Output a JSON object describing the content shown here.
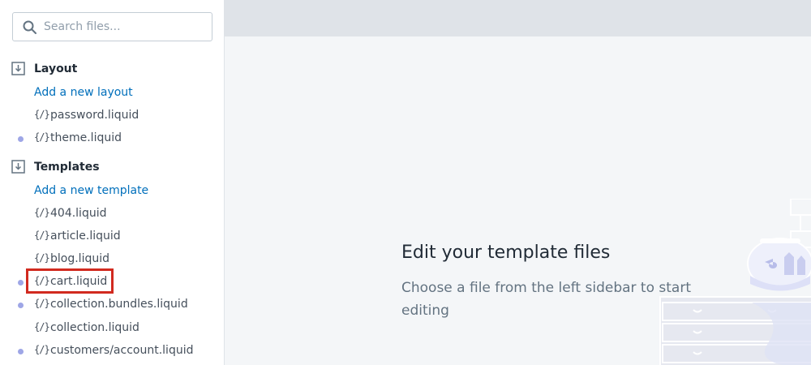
{
  "search": {
    "placeholder": "Search files..."
  },
  "sections": {
    "layout": {
      "title": "Layout",
      "add_label": "Add a new layout",
      "files": [
        {
          "name": "password.liquid",
          "modified": false
        },
        {
          "name": "theme.liquid",
          "modified": true
        }
      ]
    },
    "templates": {
      "title": "Templates",
      "add_label": "Add a new template",
      "files": [
        {
          "name": "404.liquid",
          "modified": false
        },
        {
          "name": "article.liquid",
          "modified": false
        },
        {
          "name": "blog.liquid",
          "modified": false
        },
        {
          "name": "cart.liquid",
          "modified": true
        },
        {
          "name": "collection.bundles.liquid",
          "modified": true
        },
        {
          "name": "collection.liquid",
          "modified": false
        },
        {
          "name": "customers/account.liquid",
          "modified": true
        }
      ]
    }
  },
  "file_icon_glyph": "{/}",
  "empty_state": {
    "title": "Edit your template files",
    "description": "Choose a file from the left sidebar to start editing"
  },
  "colors": {
    "link": "#006fbb",
    "modified_dot": "#9ea6e6",
    "highlight": "#d12a1f",
    "topbar": "#dfe3e8",
    "main_bg": "#f4f6f8"
  }
}
